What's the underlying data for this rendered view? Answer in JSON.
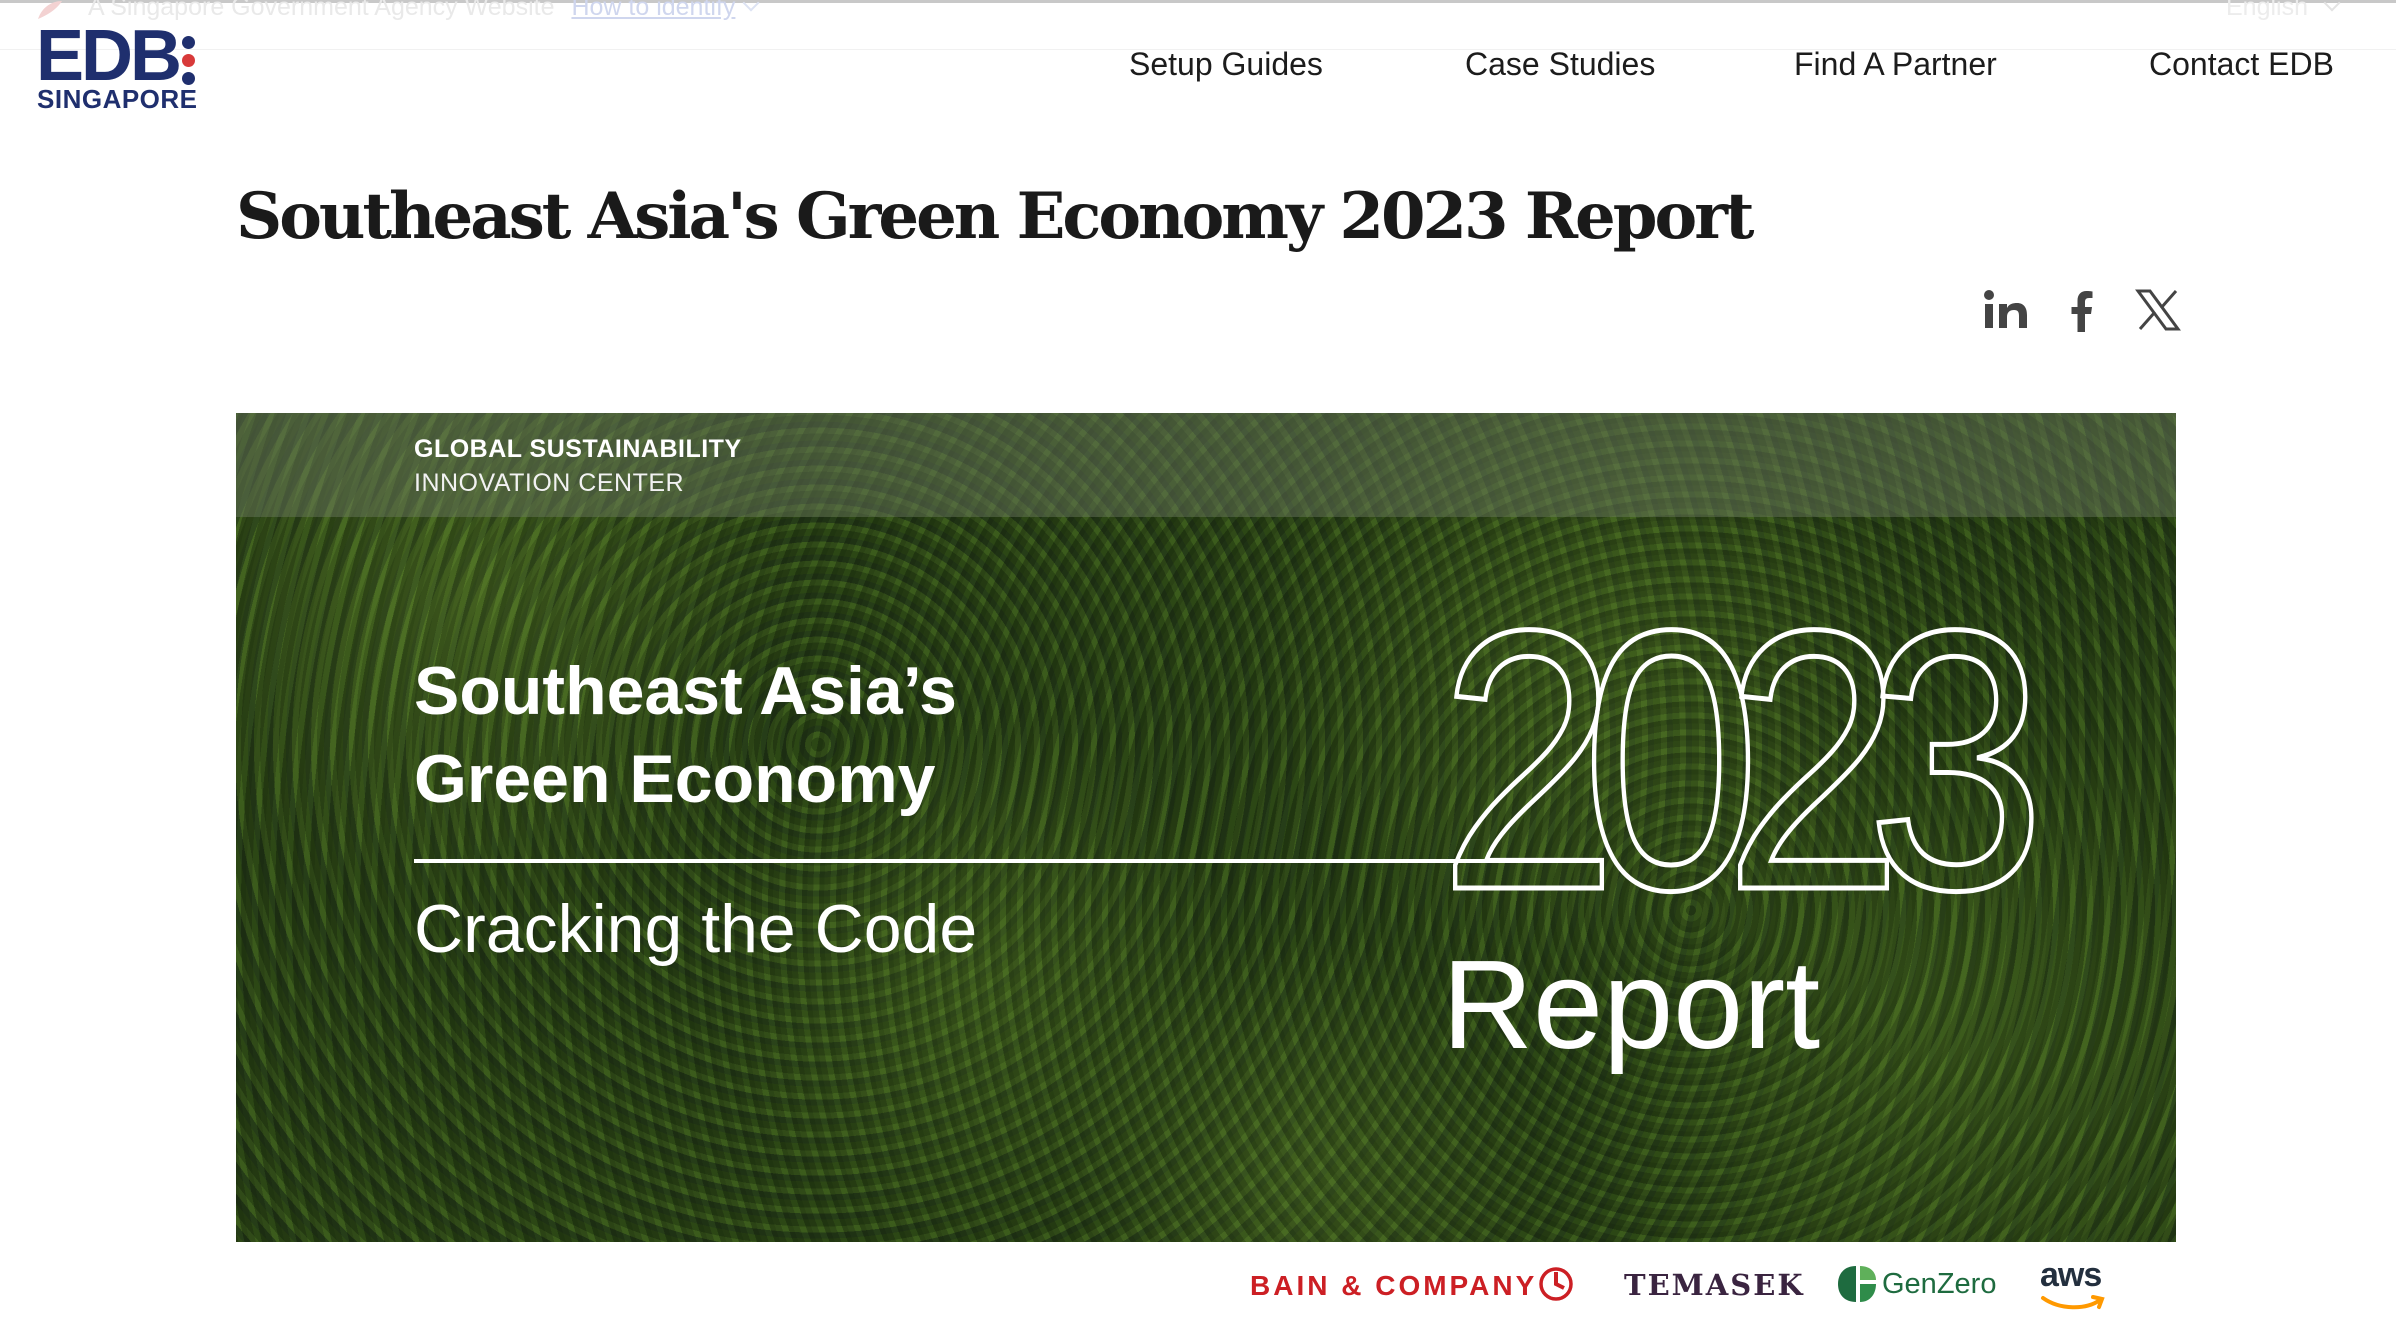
{
  "gov_banner": {
    "text": "A Singapore Government Agency Website",
    "link": "How to identify",
    "language": "English"
  },
  "logo": {
    "main": "EDB",
    "sub": "SINGAPORE",
    "dot_colors": [
      "#1f2f6e",
      "#d83a3a",
      "#1f2f6e"
    ]
  },
  "nav": {
    "items": [
      {
        "label": "Setup Guides"
      },
      {
        "label": "Case Studies"
      },
      {
        "label": "Find A Partner"
      },
      {
        "label": "Contact EDB"
      }
    ]
  },
  "page": {
    "title": "Southeast Asia's Green Economy 2023 Report"
  },
  "share": {
    "icons": [
      "linkedin-icon",
      "facebook-icon",
      "x-icon"
    ]
  },
  "hero": {
    "org_line1": "GLOBAL SUSTAINABILITY",
    "org_line2": "INNOVATION CENTER",
    "title_line1": "Southeast Asia’s",
    "title_line2": "Green Economy",
    "subtitle": "Cracking the Code",
    "year": "2023",
    "report": "Report"
  },
  "partners": {
    "bain": "BAIN & COMPANY",
    "temasek": "TEMASEK",
    "genzero": "GenZero",
    "aws": "aws"
  },
  "colors": {
    "brand_navy": "#1f2f6e",
    "brand_red": "#d83a3a",
    "bain_red": "#cc1f24",
    "temasek_purple": "#3a2440",
    "genzero_green": "#1e6b3f",
    "aws_orange": "#ff9900"
  }
}
